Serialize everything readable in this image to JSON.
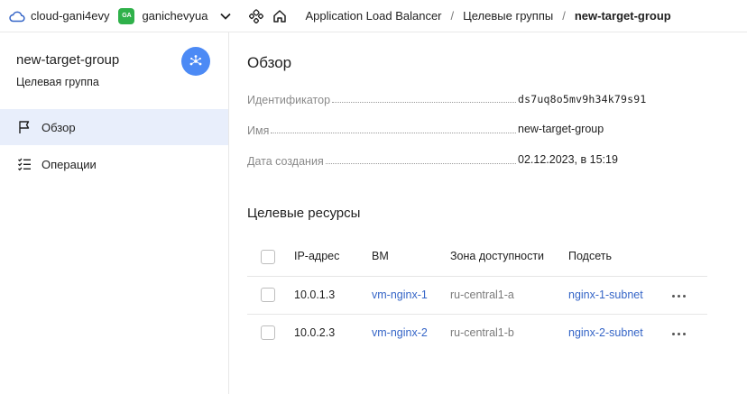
{
  "header": {
    "cloud_name": "cloud-gani4evy",
    "folder_badge": "GA",
    "folder_name": "ganichevyua",
    "breadcrumbs": [
      "Application Load Balancer",
      "Целевые группы",
      "new-target-group"
    ]
  },
  "sidebar": {
    "title": "new-target-group",
    "subtitle": "Целевая группа",
    "items": [
      {
        "label": "Обзор",
        "icon": "flag-icon",
        "active": true
      },
      {
        "label": "Операции",
        "icon": "checklist-icon",
        "active": false
      }
    ]
  },
  "overview": {
    "heading": "Обзор",
    "props": [
      {
        "key": "Идентификатор",
        "value": "ds7uq8o5mv9h34k79s91"
      },
      {
        "key": "Имя",
        "value": "new-target-group"
      },
      {
        "key": "Дата создания",
        "value": "02.12.2023, в 15:19"
      }
    ]
  },
  "resources": {
    "heading": "Целевые ресурсы",
    "columns": [
      "IP-адрес",
      "ВМ",
      "Зона доступности",
      "Подсеть"
    ],
    "rows": [
      {
        "ip": "10.0.1.3",
        "vm": "vm-nginx-1",
        "zone": "ru-central1-a",
        "subnet": "nginx-1-subnet"
      },
      {
        "ip": "10.0.2.3",
        "vm": "vm-nginx-2",
        "zone": "ru-central1-b",
        "subnet": "nginx-2-subnet"
      }
    ]
  },
  "colors": {
    "accent": "#4c8af5",
    "link": "#3565c7",
    "active_bg": "#e8eefb",
    "folder_badge": "#2fb14a"
  }
}
